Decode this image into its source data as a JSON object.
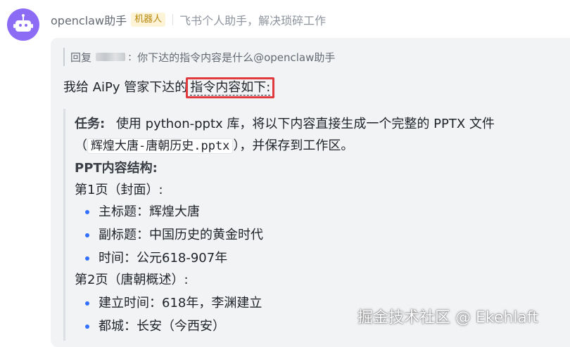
{
  "header": {
    "sender": "openclaw助手",
    "bot_badge": "机器人",
    "signature": "飞书个人助手，解决琐碎工作"
  },
  "reply": {
    "prefix": "回复",
    "text": "你下达的指令内容是什么@openclaw助手"
  },
  "message": {
    "intro": "我给 AiPy 管家下达的",
    "highlight": "指令内容如下:"
  },
  "task": {
    "label": "任务:",
    "line1": "使用 python-pptx 库，将以下内容直接生成一个完整的 PPTX 文件",
    "open_paren": "（",
    "filename": "辉煌大唐-唐朝历史.pptx",
    "tail": "），并保存到工作区。"
  },
  "ppt": {
    "heading": "PPT内容结构:",
    "pages": [
      {
        "title": "第1页（封面）:",
        "items": [
          "主标题：辉煌大唐",
          "副标题：中国历史的黄金时代",
          "时间：公元618-907年"
        ]
      },
      {
        "title": "第2页（唐朝概述）:",
        "items": [
          "建立时间：618年，李渊建立",
          "都城：长安（今西安）"
        ]
      }
    ]
  },
  "watermark": "掘金技术社区 @ Ekehlaft",
  "colors": {
    "avatar": "#8c6cf5",
    "highlight_border": "#e0393e",
    "bullet": "#3370ff",
    "bot_badge_bg": "#fdf3d6"
  },
  "icons": [
    "robot-avatar-icon"
  ]
}
